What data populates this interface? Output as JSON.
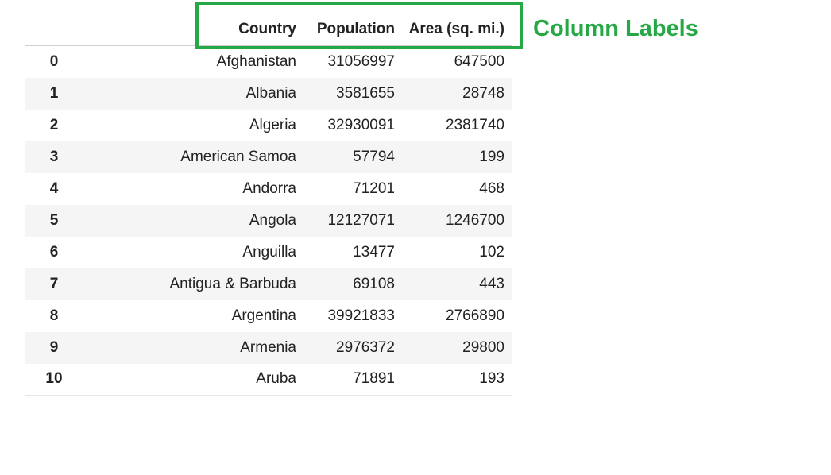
{
  "annotation": {
    "label": "Column Labels",
    "color": "#27a846"
  },
  "table": {
    "columns": [
      "Country",
      "Population",
      "Area (sq. mi.)"
    ],
    "rows": [
      {
        "index": "0",
        "country": "Afghanistan",
        "population": "31056997",
        "area": "647500"
      },
      {
        "index": "1",
        "country": "Albania",
        "population": "3581655",
        "area": "28748"
      },
      {
        "index": "2",
        "country": "Algeria",
        "population": "32930091",
        "area": "2381740"
      },
      {
        "index": "3",
        "country": "American Samoa",
        "population": "57794",
        "area": "199"
      },
      {
        "index": "4",
        "country": "Andorra",
        "population": "71201",
        "area": "468"
      },
      {
        "index": "5",
        "country": "Angola",
        "population": "12127071",
        "area": "1246700"
      },
      {
        "index": "6",
        "country": "Anguilla",
        "population": "13477",
        "area": "102"
      },
      {
        "index": "7",
        "country": "Antigua & Barbuda",
        "population": "69108",
        "area": "443"
      },
      {
        "index": "8",
        "country": "Argentina",
        "population": "39921833",
        "area": "2766890"
      },
      {
        "index": "9",
        "country": "Armenia",
        "population": "2976372",
        "area": "29800"
      },
      {
        "index": "10",
        "country": "Aruba",
        "population": "71891",
        "area": "193"
      }
    ]
  }
}
